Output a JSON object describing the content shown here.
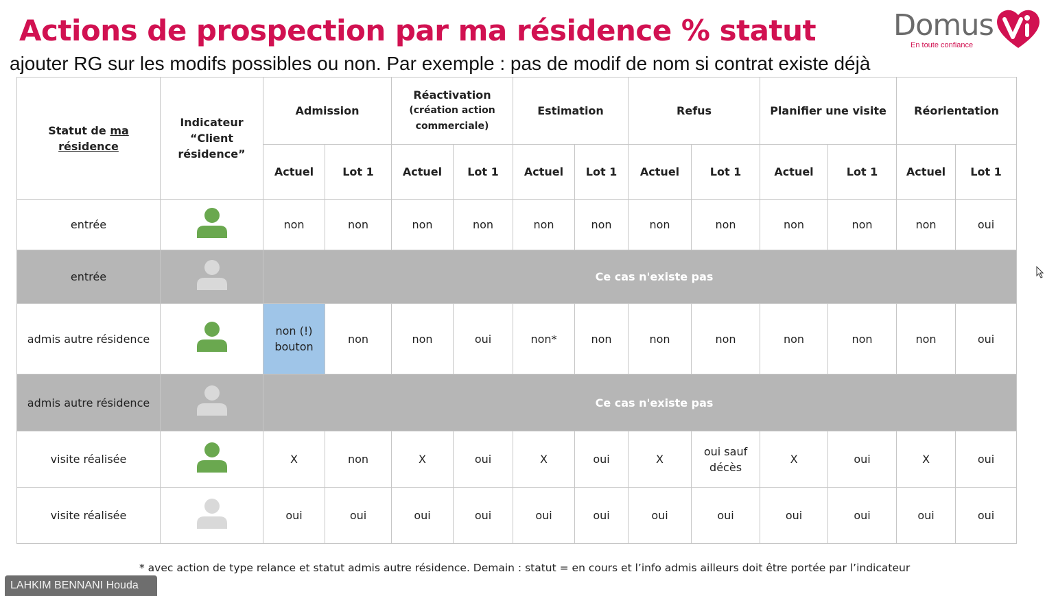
{
  "page": {
    "title": "Actions de prospection par ma résidence % statut",
    "subtitle": "ajouter RG sur les modifs possibles ou non. Par exemple : pas de modif de nom si contrat existe déjà"
  },
  "logo": {
    "name": "Domus",
    "letter": "V",
    "i_letter": "i",
    "tagline": "En toute confiance",
    "brand_color": "#d11151"
  },
  "table": {
    "col_status_pre": "Statut de ",
    "col_status_underlined_1": "ma",
    "col_status_underlined_2": "résidence",
    "col_indicator_l1": "Indicateur",
    "col_indicator_l2": "“Client",
    "col_indicator_l3": "résidence”",
    "groups": [
      {
        "label": "Admission"
      },
      {
        "label": "Réactivation",
        "sub1": "(création action",
        "sub2": "commerciale)"
      },
      {
        "label": "Estimation"
      },
      {
        "label": "Refus"
      },
      {
        "label": "Planifier une visite"
      },
      {
        "label": "Réorientation"
      }
    ],
    "sub_actuel": "Actuel",
    "sub_lot1": "Lot 1",
    "not_exists": "Ce cas n'existe pas",
    "rows": [
      {
        "status": "entrée",
        "client": true,
        "cells": [
          "non",
          "non",
          "non",
          "non",
          "non",
          "non",
          "non",
          "non",
          "non",
          "non",
          "non",
          "oui"
        ]
      },
      {
        "status": "entrée",
        "client": false,
        "na": true
      },
      {
        "status": "admis autre résidence",
        "client": true,
        "cells": [
          "non (!)|bouton",
          "non",
          "non",
          "oui",
          "non*",
          "non",
          "non",
          "non",
          "non",
          "non",
          "non",
          "oui"
        ]
      },
      {
        "status": "admis autre résidence",
        "client": false,
        "na": true
      },
      {
        "status": "visite réalisée",
        "client": true,
        "cells": [
          "X",
          "non",
          "X",
          "oui",
          "X",
          "oui",
          "X",
          "oui sauf|décès",
          "X",
          "oui",
          "X",
          "oui"
        ]
      },
      {
        "status": "visite réalisée",
        "client": false,
        "cells": [
          "oui",
          "oui",
          "oui",
          "oui",
          "oui",
          "oui",
          "oui",
          "oui",
          "oui",
          "oui",
          "oui",
          "oui"
        ]
      }
    ]
  },
  "colors": {
    "person_client": "#6aa84f",
    "person_nonclient": "#d9d9d9",
    "na_row": "#b6b6b6",
    "highlight": "#9fc5e8"
  },
  "footnote": "* avec action de type relance et statut admis autre résidence. Demain : statut = en cours et l’info admis ailleurs doit être portée par l’indicateur",
  "presenter": "LAHKIM BENNANI Houda"
}
